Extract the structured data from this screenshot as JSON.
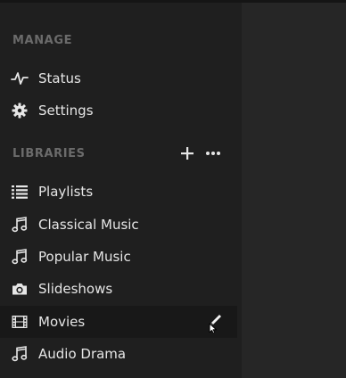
{
  "manage": {
    "title": "MANAGE",
    "items": [
      {
        "label": "Status",
        "icon": "activity-icon"
      },
      {
        "label": "Settings",
        "icon": "gear-icon"
      }
    ]
  },
  "libraries": {
    "title": "LIBRARIES",
    "add_icon": "plus-icon",
    "more_icon": "more-horizontal-icon",
    "items": [
      {
        "label": "Playlists",
        "icon": "list-icon"
      },
      {
        "label": "Classical Music",
        "icon": "music-note-icon"
      },
      {
        "label": "Popular Music",
        "icon": "music-note-icon"
      },
      {
        "label": "Slideshows",
        "icon": "camera-icon"
      },
      {
        "label": "Movies",
        "icon": "film-icon",
        "active": true,
        "action_icon": "pencil-icon"
      },
      {
        "label": "Audio Drama",
        "icon": "music-note-icon"
      }
    ]
  },
  "colors": {
    "sidebar_bg": "#1f1f1f",
    "main_bg": "#262626",
    "active_row_bg": "#181818",
    "section_title": "#6b6b6b",
    "text": "#e6e6e6"
  }
}
